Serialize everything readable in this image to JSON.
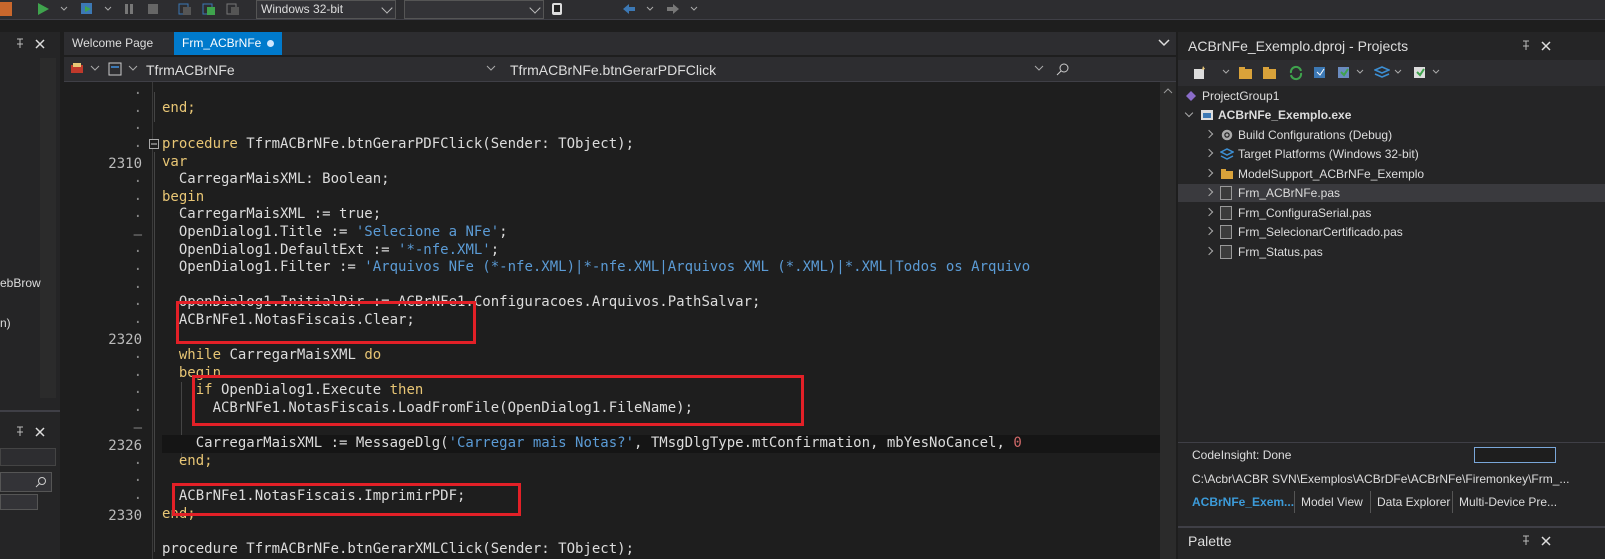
{
  "toolbar": {
    "platform_select": "Windows 32-bit",
    "config_select": ""
  },
  "left_panel": {
    "cut_label_1": "ebBrow",
    "cut_label_2": "n)"
  },
  "editor": {
    "tabs": [
      {
        "label": "Welcome Page"
      },
      {
        "label": "Frm_ACBrNFe"
      }
    ],
    "class_combo": "TfrmACBrNFe",
    "method_combo": "TfrmACBrNFe.btnGerarPDFClick",
    "line_numbers": {
      "l2310": "2310",
      "l2320": "2320",
      "l2326": "2326",
      "l2330": "2330"
    },
    "code": {
      "end1": "end;",
      "proc_kw": "procedure",
      "proc_rest": " TfrmACBrNFe.btnGerarPDFClick(Sender: TObject);",
      "var_kw": "var",
      "decl": "  CarregarMaisXML: Boolean;",
      "begin_kw": "begin",
      "assign_true": "  CarregarMaisXML := true;",
      "title_pre": "  OpenDialog1.Title := ",
      "title_str": "'Selecione a NFe'",
      "title_end": ";",
      "ext_pre": "  OpenDialog1.DefaultExt := ",
      "ext_str": "'*-nfe.XML'",
      "ext_end": ";",
      "filter_pre": "  OpenDialog1.Filter := ",
      "filter_str": "'Arquivos NFe (*-nfe.XML)|*-nfe.XML|Arquivos XML (*.XML)|*.XML|Todos os Arquivo",
      "initdir": "  OpenDialog1.InitialDir := ACBrNFe1.Configuracoes.Arquivos.PathSalvar;",
      "clear": "  ACBrNFe1.NotasFiscais.Clear;",
      "while_kw": "  while",
      "while_mid": " CarregarMaisXML ",
      "do_kw": "do",
      "begin2_kw": "  begin",
      "if_kw": "    if",
      "if_mid": " OpenDialog1.Execute ",
      "then_kw": "then",
      "loadfile": "      ACBrNFe1.NotasFiscais.LoadFromFile(OpenDialog1.FileName);",
      "msg_pre": "    CarregarMaisXML := MessageDlg(",
      "msg_str": "'Carregar mais Notas?'",
      "msg_post": ", TMsgDlgType.mtConfirmation, mbYesNoCancel, ",
      "msg_num": "0",
      "end2_kw": "  end;",
      "imprimir": "  ACBrNFe1.NotasFiscais.ImprimirPDF;",
      "end3_kw": "end;",
      "next_proc": "procedure TfrmACBrNFe.btnGerarXMLClick(Sender: TObject);"
    }
  },
  "projects": {
    "title": "ACBrNFe_Exemplo.dproj - Projects",
    "tree": [
      {
        "label": "ProjectGroup1"
      },
      {
        "label": "ACBrNFe_Exemplo.exe"
      },
      {
        "label": "Build Configurations (Debug)"
      },
      {
        "label": "Target Platforms (Windows 32-bit)"
      },
      {
        "label": "ModelSupport_ACBrNFe_Exemplo"
      },
      {
        "label": "Frm_ACBrNFe.pas"
      },
      {
        "label": "Frm_ConfiguraSerial.pas"
      },
      {
        "label": "Frm_SelecionarCertificado.pas"
      },
      {
        "label": "Frm_Status.pas"
      }
    ],
    "codeinsight": "CodeInsight: Done",
    "path": "C:\\Acbr\\ACBR SVN\\Exemplos\\ACBrDFe\\ACBrNFe\\Firemonkey\\Frm_...",
    "bottom_tabs": [
      {
        "label": "ACBrNFe_Exem..."
      },
      {
        "label": "Model View"
      },
      {
        "label": "Data Explorer"
      },
      {
        "label": "Multi-Device Pre..."
      }
    ],
    "palette_title": "Palette"
  },
  "colors": {
    "accent": "#007acc",
    "highlight_box": "#e32027",
    "keyword": "#e8c675",
    "string": "#5b9bd5"
  }
}
